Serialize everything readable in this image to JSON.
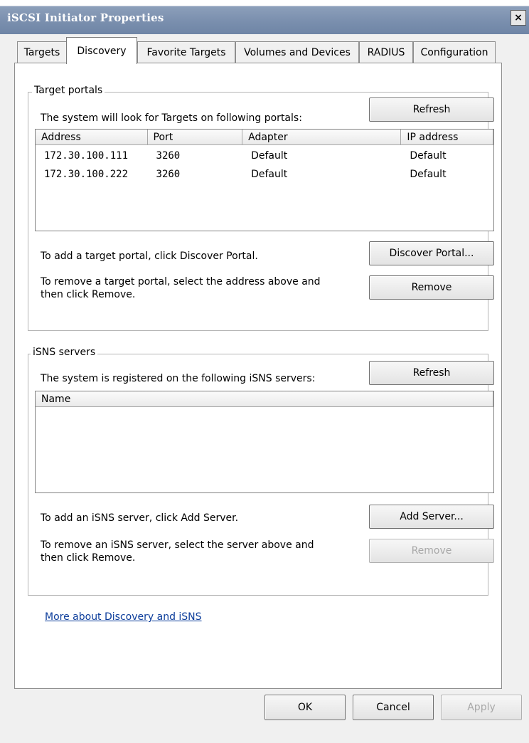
{
  "window": {
    "title": "iSCSI Initiator Properties",
    "close_glyph": "×"
  },
  "tabs": [
    {
      "label": "Targets",
      "active": false
    },
    {
      "label": "Discovery",
      "active": true
    },
    {
      "label": "Favorite Targets",
      "active": false
    },
    {
      "label": "Volumes and Devices",
      "active": false
    },
    {
      "label": "RADIUS",
      "active": false
    },
    {
      "label": "Configuration",
      "active": false
    }
  ],
  "target_portals": {
    "group_title": "Target portals",
    "description": "The system will look for Targets on following portals:",
    "refresh_label": "Refresh",
    "columns": [
      "Address",
      "Port",
      "Adapter",
      "IP address"
    ],
    "rows": [
      {
        "address": "172.30.100.111",
        "port": "3260",
        "adapter": "Default",
        "ip": "Default"
      },
      {
        "address": "172.30.100.222",
        "port": "3260",
        "adapter": "Default",
        "ip": "Default"
      }
    ],
    "add_hint": "To add a target portal, click Discover Portal.",
    "discover_label": "Discover Portal...",
    "remove_hint_line1": "To remove a target portal, select the address above and",
    "remove_hint_line2": "then click Remove.",
    "remove_label": "Remove"
  },
  "isns_servers": {
    "group_title": "iSNS servers",
    "description": "The system is registered on the following iSNS servers:",
    "refresh_label": "Refresh",
    "columns": [
      "Name"
    ],
    "add_hint": "To add an iSNS server, click Add Server.",
    "add_label": "Add Server...",
    "remove_hint_line1": "To remove an iSNS server, select the server above and",
    "remove_hint_line2": "then click Remove.",
    "remove_label": "Remove",
    "remove_enabled": false
  },
  "more_link": "More about Discovery and iSNS",
  "footer": {
    "ok_label": "OK",
    "cancel_label": "Cancel",
    "apply_label": "Apply",
    "apply_enabled": false
  },
  "colors": {
    "titlebar": "#7a8fae",
    "link": "#0c3d9b",
    "disabled_text": "#a8a8a8",
    "panel": "#ffffff",
    "window": "#f0f0f0"
  }
}
